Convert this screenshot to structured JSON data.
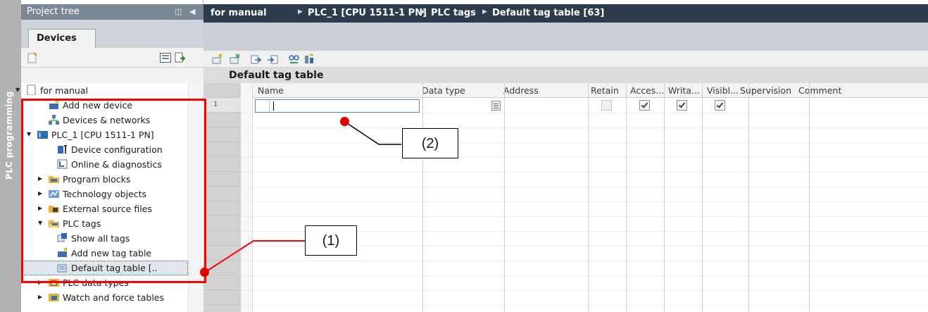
{
  "side_tab": {
    "label": "PLC programming"
  },
  "project_tree": {
    "title": "Project tree",
    "tab_label": "Devices",
    "items": [
      {
        "label": "for manual",
        "expander": "expanded",
        "icon": "project-icon"
      },
      {
        "label": "Add new device",
        "expander": "none",
        "icon": "add-device-icon"
      },
      {
        "label": "Devices & networks",
        "expander": "none",
        "icon": "network-icon"
      },
      {
        "label": "PLC_1 [CPU 1511-1 PN]",
        "expander": "expanded",
        "icon": "plc-icon"
      },
      {
        "label": "Device configuration",
        "expander": "none",
        "icon": "device-config-icon"
      },
      {
        "label": "Online & diagnostics",
        "expander": "none",
        "icon": "diagnostics-icon"
      },
      {
        "label": "Program blocks",
        "expander": "collapsed",
        "icon": "folder-icon"
      },
      {
        "label": "Technology objects",
        "expander": "collapsed",
        "icon": "technology-icon"
      },
      {
        "label": "External source files",
        "expander": "collapsed",
        "icon": "source-files-icon"
      },
      {
        "label": "PLC tags",
        "expander": "expanded",
        "icon": "folder-open-icon"
      },
      {
        "label": "Show all tags",
        "expander": "none",
        "icon": "tags-icon"
      },
      {
        "label": "Add new tag table",
        "expander": "none",
        "icon": "add-table-icon"
      },
      {
        "label": "Default tag table [..",
        "expander": "none",
        "icon": "tag-table-icon",
        "selected": true
      },
      {
        "label": "PLC data types",
        "expander": "collapsed",
        "icon": "data-types-icon"
      },
      {
        "label": "Watch and force tables",
        "expander": "collapsed",
        "icon": "watch-table-icon"
      }
    ]
  },
  "breadcrumb": [
    "for manual",
    "PLC_1 [CPU 1511-1 PN]",
    "PLC tags",
    "Default tag table [63]"
  ],
  "editor": {
    "table_title": "Default tag table",
    "columns": [
      "Name",
      "Data type",
      "Address",
      "Retain",
      "Acces...",
      "Writa...",
      "Visibl...",
      "Supervision",
      "Comment"
    ],
    "rows": [
      {
        "number": "1",
        "name": "",
        "data_type": "",
        "address": "",
        "retain": false,
        "accessible": true,
        "writable": true,
        "visible": true,
        "supervision": "",
        "comment": ""
      }
    ]
  },
  "annotations": [
    {
      "label": "(1)"
    },
    {
      "label": "(2)"
    }
  ],
  "colors": {
    "annotation_red": "#ff0000",
    "breadcrumb_bg": "#2d3b4c",
    "tree_header_bg": "#7a8896",
    "side_tab_bg": "#b2b2b2"
  }
}
